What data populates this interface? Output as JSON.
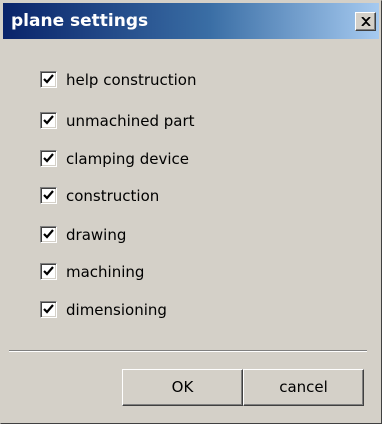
{
  "window": {
    "title": "plane settings",
    "close_icon": "close-icon"
  },
  "options": [
    {
      "label": "help construction",
      "checked": true
    },
    {
      "label": "unmachined part",
      "checked": true
    },
    {
      "label": "clamping device",
      "checked": true
    },
    {
      "label": "construction",
      "checked": true
    },
    {
      "label": "drawing",
      "checked": true
    },
    {
      "label": "machining",
      "checked": true
    },
    {
      "label": "dimensioning",
      "checked": true
    }
  ],
  "buttons": {
    "ok_label": "OK",
    "cancel_label": "cancel"
  },
  "colors": {
    "titlebar_start": "#0a246a",
    "titlebar_end": "#a6caf0",
    "face": "#d4d0c8"
  }
}
